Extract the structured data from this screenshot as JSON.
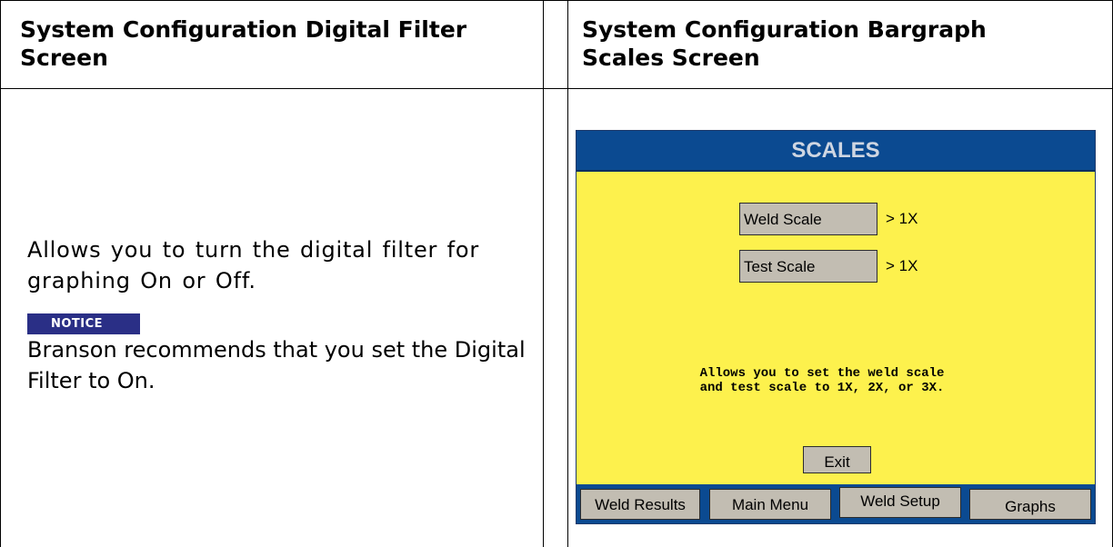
{
  "table": {
    "left_header": "System Configuration Digital Filter Screen",
    "right_header": "System Configuration Bargraph Scales Screen",
    "description": "Allows you to turn the digital filter for graphing On or Off.",
    "notice_label": "NOTICE",
    "notice_text": "Branson recommends that you set the Digital Filter to On."
  },
  "screen": {
    "title": "SCALES",
    "weld_scale_label": "Weld Scale",
    "weld_scale_value": "> 1X",
    "test_scale_label": "Test Scale",
    "test_scale_value": "> 1X",
    "info_line1": "Allows you to set the weld scale",
    "info_line2": "and test scale to 1X, 2X, or 3X.",
    "exit_label": "Exit",
    "colors": {
      "title_bar": "#0b4a91",
      "background": "#fdf14d",
      "button": "#c2bdb2"
    },
    "nav": {
      "weld_results": "Weld Results",
      "main_menu": "Main Menu",
      "weld_setup": "Weld Setup",
      "graphs": "Graphs"
    }
  }
}
